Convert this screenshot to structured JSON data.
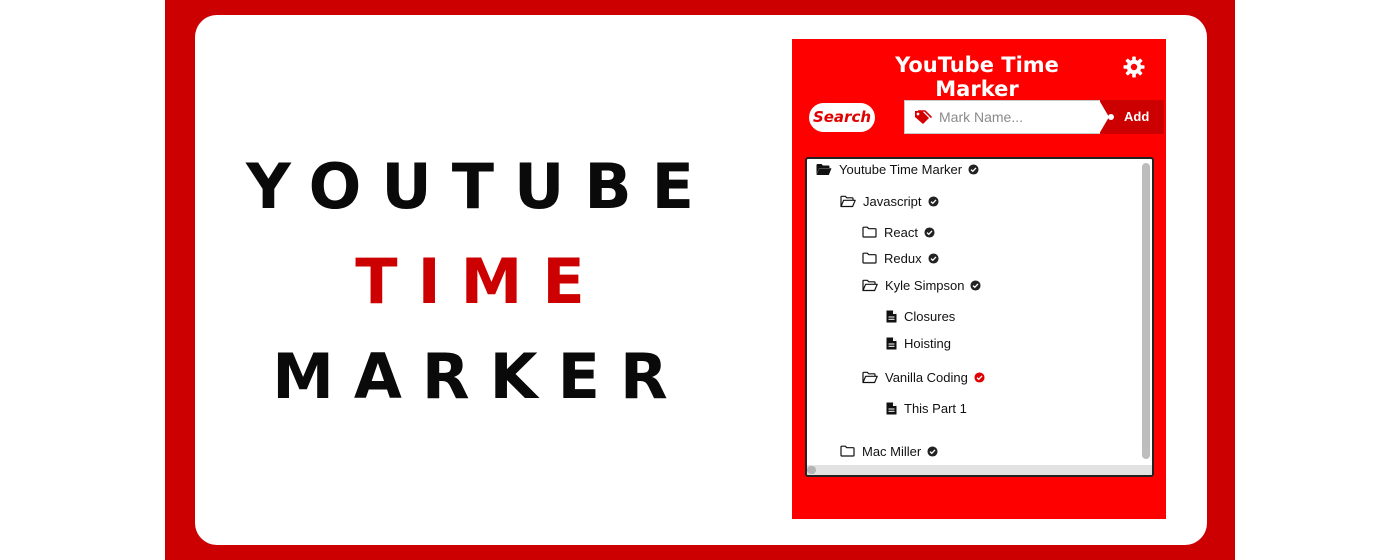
{
  "banner": {
    "line1": "YOUTUBE",
    "line2": "TIME",
    "line3": "MARKER",
    "frame_color": "#cc0000",
    "accent_color": "#cc0000"
  },
  "popup": {
    "title": "YouTube Time Marker",
    "settings_icon": "gear-icon",
    "background": "#ff0000",
    "search_label": "Search",
    "mark_input": {
      "value": "",
      "placeholder": "Mark Name...",
      "icon": "tag-icon"
    },
    "add_label": "Add"
  },
  "tree": [
    {
      "label": "Youtube Time Marker",
      "type": "folder-open-filled",
      "check": "dark"
    },
    {
      "label": "Javascript",
      "type": "folder-open",
      "check": "dark"
    },
    {
      "label": "React",
      "type": "folder",
      "check": "dark"
    },
    {
      "label": "Redux",
      "type": "folder",
      "check": "dark"
    },
    {
      "label": "Kyle Simpson",
      "type": "folder-open",
      "check": "dark"
    },
    {
      "label": "Closures",
      "type": "file",
      "check": "none"
    },
    {
      "label": "Hoisting",
      "type": "file",
      "check": "none"
    },
    {
      "label": "Vanilla Coding",
      "type": "folder-open",
      "check": "red"
    },
    {
      "label": "This Part 1",
      "type": "file",
      "check": "none"
    },
    {
      "label": "Mac Miller",
      "type": "folder",
      "check": "dark"
    }
  ]
}
